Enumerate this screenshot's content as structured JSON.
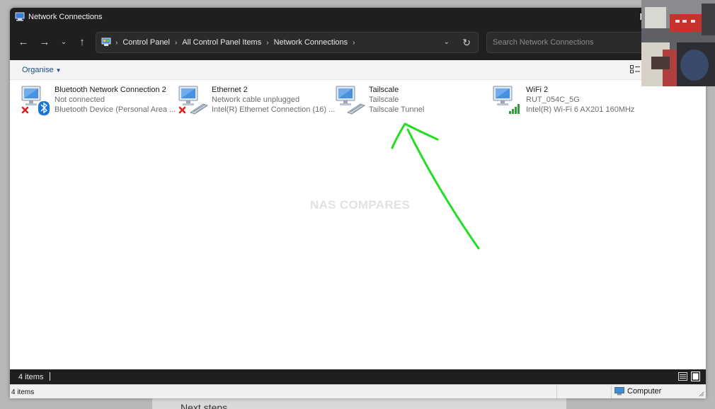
{
  "window": {
    "title": "Network Connections"
  },
  "navigation": {
    "breadcrumbs": [
      "Control Panel",
      "All Control Panel Items",
      "Network Connections"
    ],
    "search_placeholder": "Search Network Connections"
  },
  "commandbar": {
    "organise_label": "Organise"
  },
  "connections": [
    {
      "name": "Bluetooth Network Connection 2",
      "status": "Not connected",
      "device": "Bluetooth Device (Personal Area ...",
      "icon": "bluetooth-network-icon",
      "state": "disconnected"
    },
    {
      "name": "Ethernet 2",
      "status": "Network cable unplugged",
      "device": "Intel(R) Ethernet Connection (16) ...",
      "icon": "ethernet-network-icon",
      "state": "disconnected"
    },
    {
      "name": "Tailscale",
      "status": "Tailscale",
      "device": "Tailscale Tunnel",
      "icon": "tunnel-network-icon",
      "state": "connected"
    },
    {
      "name": "WiFi 2",
      "status": "RUT_054C_5G",
      "device": "Intel(R) Wi-Fi 6 AX201 160MHz",
      "icon": "wifi-network-icon",
      "state": "connected"
    }
  ],
  "watermark": "NAS COMPARES",
  "annotation": {
    "type": "hand-drawn-arrow",
    "color": "#22dd22",
    "points_to": "Tailscale"
  },
  "statusbar": {
    "item_count": "4 items"
  },
  "legacy_statusbar": {
    "item_count": "4 items",
    "zone_label": "Computer"
  },
  "background": {
    "text": "Next steps"
  },
  "colors": {
    "titlebar": "#1f1f1f",
    "accent_link": "#1f4d8a",
    "error_red": "#e02020",
    "bluetooth_blue": "#1a73d6"
  }
}
